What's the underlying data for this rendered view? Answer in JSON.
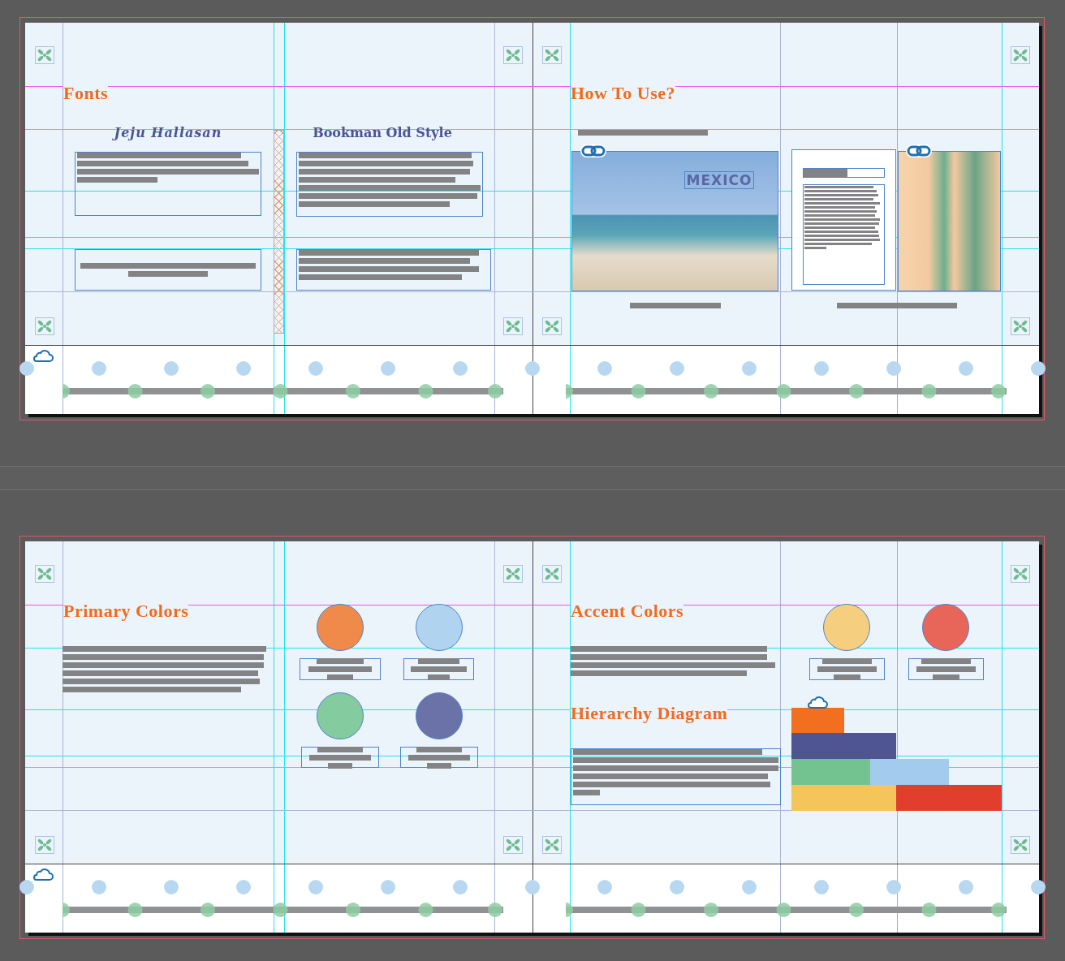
{
  "spreads": [
    {
      "pages": [
        {
          "kind": "fonts",
          "heading": "Fonts",
          "samples": [
            {
              "kind": "display",
              "name": "Jeju Hallasan"
            },
            {
              "kind": "serif",
              "name": "Bookman Old Style"
            }
          ]
        },
        {
          "kind": "guide",
          "heading": "How To Use?",
          "photo_caption": "MEXICO"
        }
      ]
    },
    {
      "pages": [
        {
          "kind": "swatches",
          "heading": "Primary Colors",
          "swatches": [
            {
              "color": "#f08a4b"
            },
            {
              "color": "#b0d4f0"
            },
            {
              "color": "#85cba0"
            },
            {
              "color": "#6b72a8"
            }
          ]
        },
        {
          "kind": "accents",
          "heading": "Accent Colors",
          "swatches": [
            {
              "color": "#f5cf7f"
            },
            {
              "color": "#e8655a"
            }
          ],
          "subheading": "Hierarchy Diagram",
          "diagram_blocks": [
            {
              "color": "#f26f1f"
            },
            {
              "color": "#4e5591"
            },
            {
              "color": "#72c38f"
            },
            {
              "color": "#a3cbee"
            },
            {
              "color": "#f4c55b"
            },
            {
              "color": "#e23e2e"
            }
          ]
        }
      ]
    }
  ]
}
